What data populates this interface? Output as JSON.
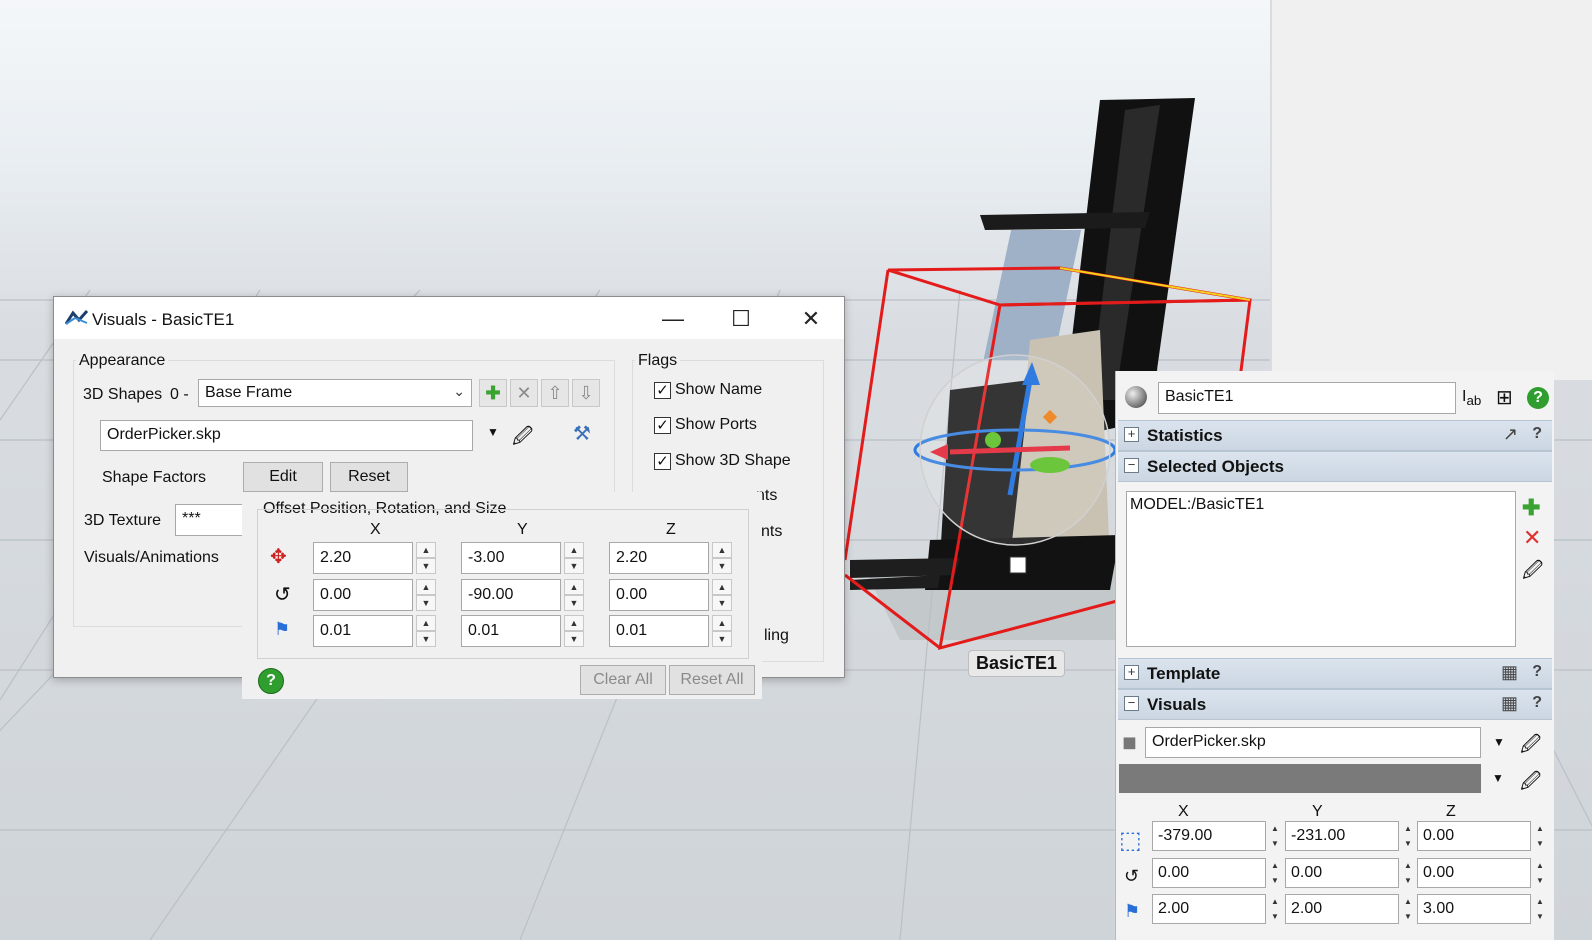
{
  "dialog": {
    "title": "Visuals - BasicTE1",
    "appearance_label": "Appearance",
    "shapes_label": "3D Shapes",
    "shape_index": "0 -",
    "shape_selected": "Base Frame",
    "shape_file": "OrderPicker.skp",
    "shape_factors_label": "Shape Factors",
    "edit_label": "Edit",
    "reset_label": "Reset",
    "texture_label": "3D Texture",
    "texture_value": "***",
    "visuals_animations_label": "Visuals/Animations",
    "flags_label": "Flags",
    "flags": [
      {
        "label": "Show Name",
        "checked": true
      },
      {
        "label": "Show Ports",
        "checked": true
      },
      {
        "label": "Show 3D Shape",
        "checked": true
      }
    ],
    "partial_flag_1": "nts",
    "partial_flag_2": "nts",
    "partial_flag_3": "ling"
  },
  "offset": {
    "title": "Offset Position, Rotation, and Size",
    "col_x": "X",
    "col_y": "Y",
    "col_z": "Z",
    "position": {
      "x": "2.20",
      "y": "-3.00",
      "z": "2.20"
    },
    "rotation": {
      "x": "0.00",
      "y": "-90.00",
      "z": "0.00"
    },
    "size": {
      "x": "0.01",
      "y": "0.01",
      "z": "0.01"
    },
    "clear_all": "Clear All",
    "reset_all": "Reset All"
  },
  "props": {
    "object_name": "BasicTE1",
    "statistics": "Statistics",
    "selected_objects": "Selected Objects",
    "selected_item": "MODEL:/BasicTE1",
    "template": "Template",
    "visuals": "Visuals",
    "shape_file": "OrderPicker.skp",
    "col_x": "X",
    "col_y": "Y",
    "col_z": "Z",
    "position": {
      "x": "-379.00",
      "y": "-231.00",
      "z": "0.00"
    },
    "rotation": {
      "x": "0.00",
      "y": "0.00",
      "z": "0.00"
    },
    "size": {
      "x": "2.00",
      "y": "2.00",
      "z": "3.00"
    },
    "color_swatch": "#7a7a7a"
  },
  "scene": {
    "object_label": "BasicTE1",
    "bbox_color": "#e31b1b"
  }
}
